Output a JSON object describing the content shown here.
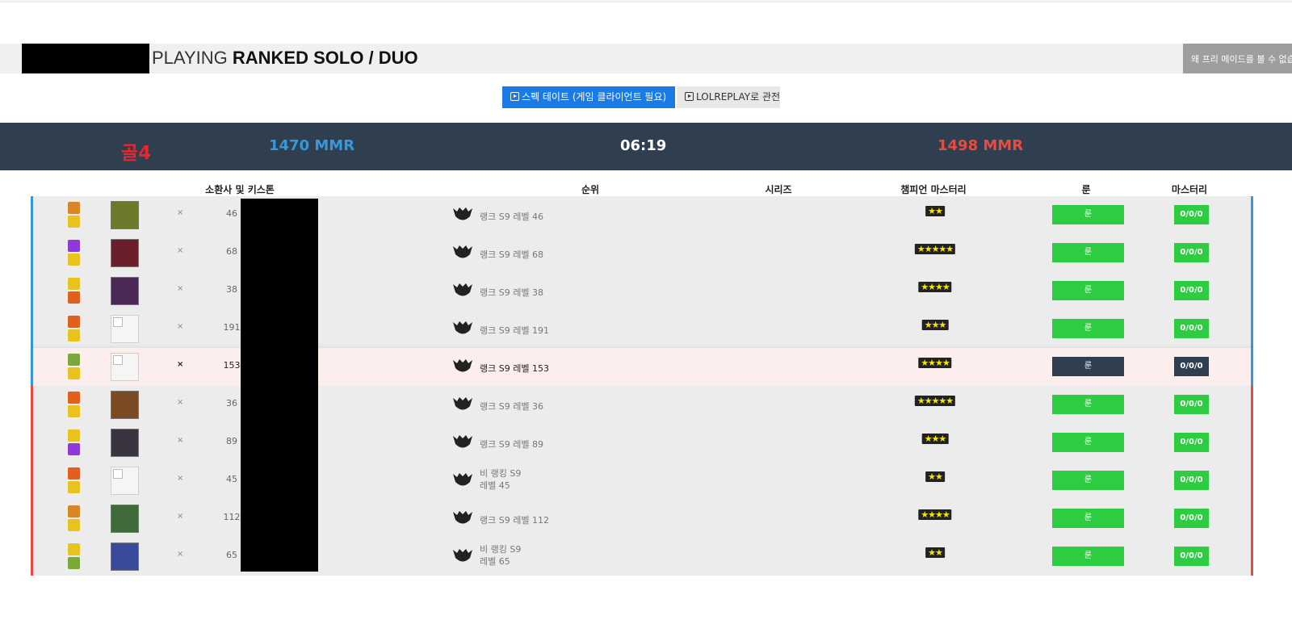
{
  "header": {
    "title_light": "PLAYING",
    "title_bold": "RANKED SOLO / DUO",
    "why_button": "왜 프리 메이드를 볼 수 없습"
  },
  "actions": {
    "spectate": "스펙 테이트 (게임 클라이언트 필요)",
    "lolreplay": "LOLREPLAY로 관전"
  },
  "scoreboard": {
    "label": "골4",
    "blue_mmr": "1470 MMR",
    "time": "06:19",
    "red_mmr": "1498 MMR"
  },
  "columns": {
    "summoner": "소환사 및 키스톤",
    "rank": "순위",
    "series": "시리즈",
    "mastery_champ": "챔피언 마스터리",
    "runes": "룬",
    "masteries": "마스터리"
  },
  "colors": {
    "blue_team": "#3498db",
    "red_team": "#e84c3d",
    "green_button": "#2ecc40",
    "dark": "#2f3f50"
  },
  "players": [
    {
      "team": "blue",
      "spells": [
        "#d9862a",
        "#e8c21f"
      ],
      "champ": "#6a7a2a",
      "x": "×",
      "level": "46",
      "rank": "랭크 S9 레벨 46",
      "stars": "★★",
      "rune": "룬",
      "mastery": "0/0/0"
    },
    {
      "team": "blue",
      "spells": [
        "#8e3ad6",
        "#e8c21f"
      ],
      "champ": "#6b1f2a",
      "x": "×",
      "level": "68",
      "rank": "랭크 S9 레벨 68",
      "stars": "★★★★★",
      "rune": "룬",
      "mastery": "0/0/0"
    },
    {
      "team": "blue",
      "spells": [
        "#e8c21f",
        "#e0601c"
      ],
      "champ": "#4a2a55",
      "x": "×",
      "level": "38",
      "rank": "랭크 S9 레벨 38",
      "stars": "★★★★",
      "rune": "룬",
      "mastery": "0/0/0"
    },
    {
      "team": "blue",
      "spells": [
        "#e0601c",
        "#e8c21f"
      ],
      "champ": "",
      "x": "×",
      "level": "191",
      "rank": "랭크 S9 레벨 191",
      "stars": "★★★",
      "rune": "룬",
      "mastery": "0/0/0"
    },
    {
      "team": "blue",
      "highlight": true,
      "spells": [
        "#7aa83a",
        "#e8c21f"
      ],
      "champ": "",
      "x": "×",
      "level": "153",
      "rank": "랭크 S9 레벨 153",
      "stars": "★★★★",
      "rune": "룬",
      "mastery": "0/0/0"
    },
    {
      "team": "red",
      "spells": [
        "#e0601c",
        "#e8c21f"
      ],
      "champ": "#7a4a22",
      "x": "×",
      "level": "36",
      "rank": "랭크 S9 레벨 36",
      "stars": "★★★★★",
      "rune": "룬",
      "mastery": "0/0/0"
    },
    {
      "team": "red",
      "spells": [
        "#e8c21f",
        "#8e3ad6"
      ],
      "champ": "#3a3440",
      "x": "×",
      "level": "89",
      "rank": "랭크 S9 레벨 89",
      "stars": "★★★",
      "rune": "룬",
      "mastery": "0/0/0"
    },
    {
      "team": "red",
      "spells": [
        "#e0601c",
        "#e8c21f"
      ],
      "champ": "",
      "x": "×",
      "level": "45",
      "rank_line1": "비 랭킹 S9",
      "rank_line2": "레벨 45",
      "stars": "★★",
      "rune": "룬",
      "mastery": "0/0/0"
    },
    {
      "team": "red",
      "spells": [
        "#d9862a",
        "#e8c21f"
      ],
      "champ": "#3f6a3a",
      "x": "×",
      "level": "112",
      "rank": "랭크 S9 레벨 112",
      "stars": "★★★★",
      "rune": "룬",
      "mastery": "0/0/0"
    },
    {
      "team": "red",
      "spells": [
        "#e8c21f",
        "#7aa83a"
      ],
      "champ": "#3a4a9a",
      "x": "×",
      "level": "65",
      "rank_line1": "비 랭킹 S9",
      "rank_line2": "레벨 65",
      "stars": "★★",
      "rune": "룬",
      "mastery": "0/0/0"
    }
  ]
}
